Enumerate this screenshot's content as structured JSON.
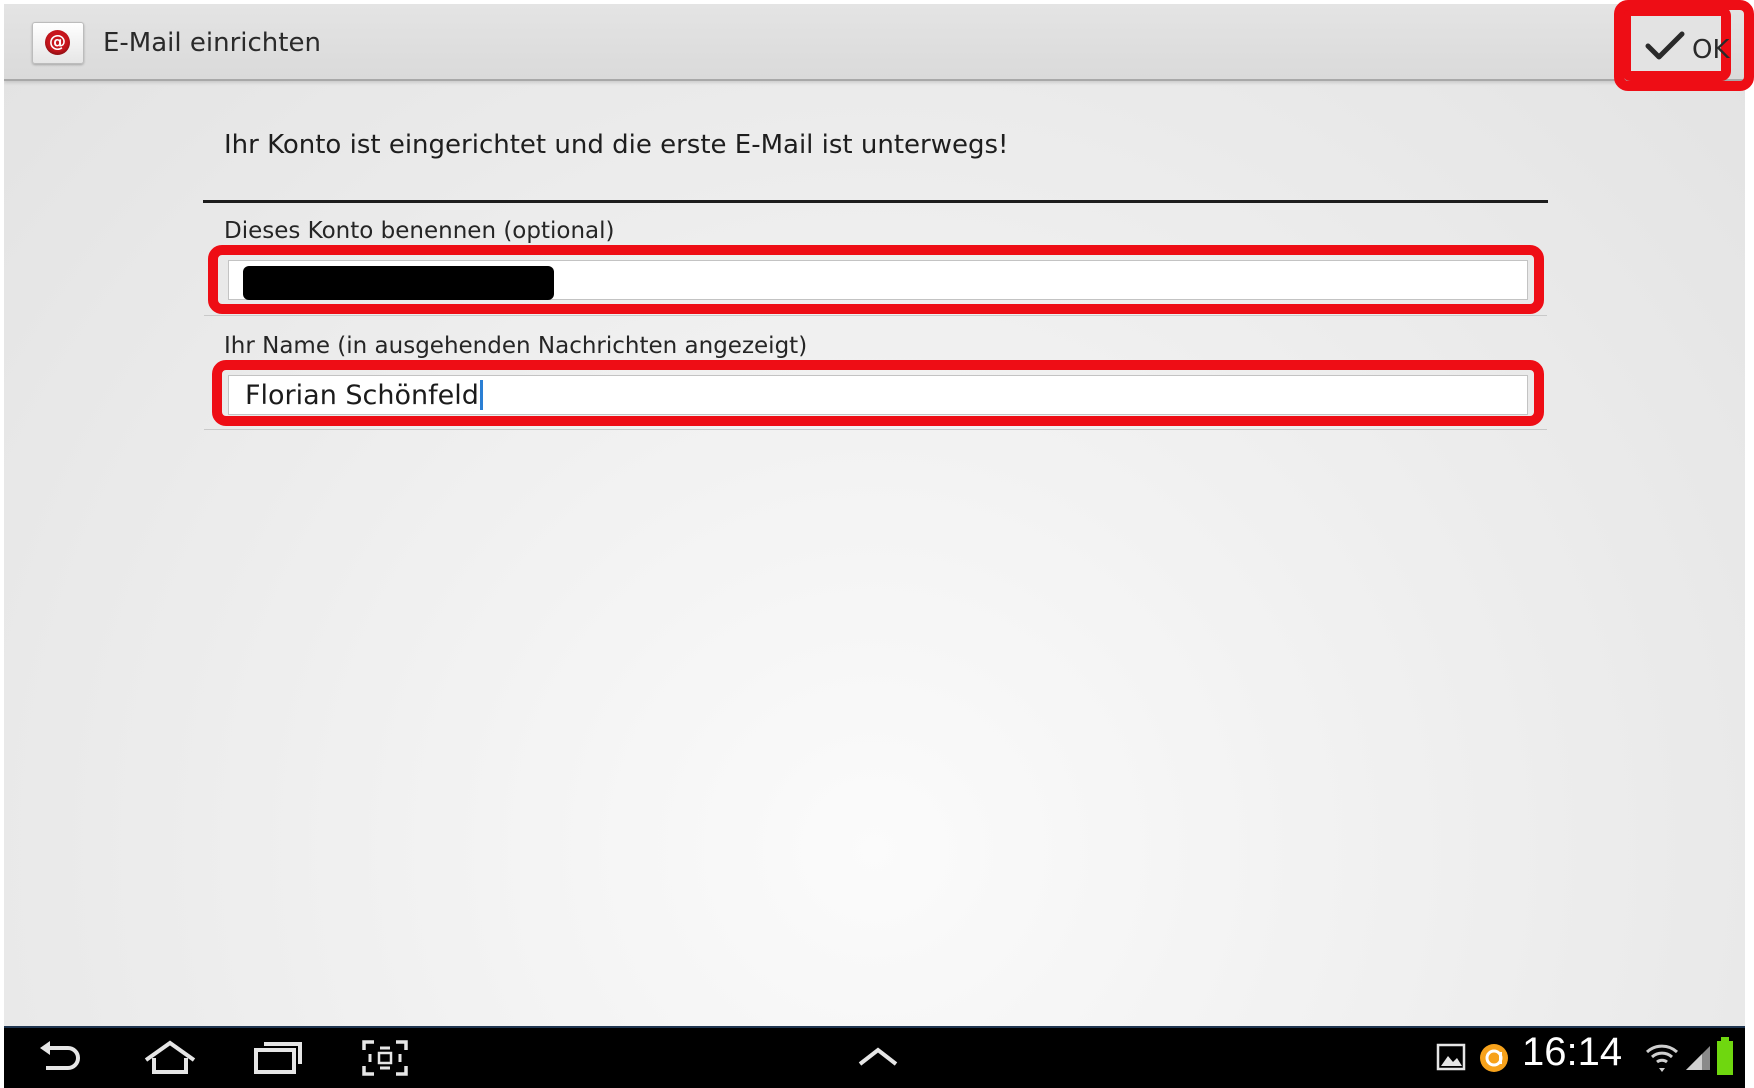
{
  "app": {
    "title": "E-Mail einrichten",
    "icon": "email-at-icon",
    "ok_label": "OK"
  },
  "content": {
    "message": "Ihr Konto ist eingerichtet und die erste E-Mail ist unterwegs!",
    "account_name": {
      "label": "Dieses Konto benennen (optional)",
      "value_redacted": true
    },
    "your_name": {
      "label": "Ihr Name (in ausgehenden Nachrichten angezeigt)",
      "value": "Florian Schönfeld"
    }
  },
  "navigation": {
    "buttons": [
      "back-icon",
      "home-icon",
      "recent-apps-icon",
      "screenshot-icon",
      "chevron-up-icon"
    ]
  },
  "status_bar": {
    "time": "16:14",
    "icons": [
      "gallery-notification-icon",
      "app-notification-icon",
      "wifi-icon",
      "signal-icon",
      "battery-icon"
    ]
  },
  "colors": {
    "highlight_red": "#ee0d15",
    "caret_blue": "#2a7fd4",
    "app_icon_red": "#c8161d"
  }
}
